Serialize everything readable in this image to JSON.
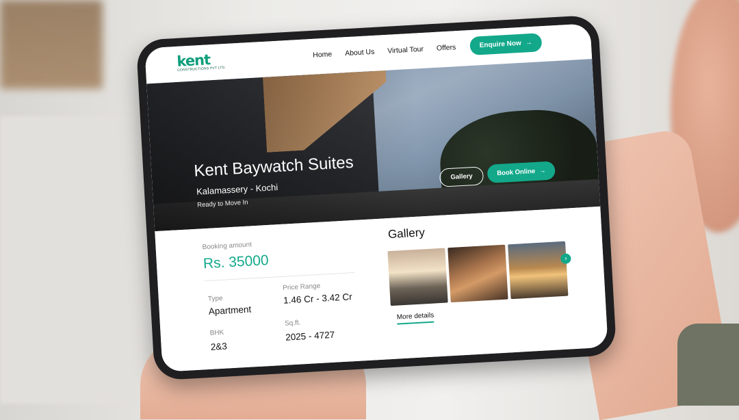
{
  "nav": {
    "logo_text": "kent",
    "logo_subtext": "CONSTRUCTIONS PVT LTD.",
    "links": [
      "Home",
      "About Us",
      "Virtual Tour",
      "Offers"
    ],
    "cta_label": "Enquire Now",
    "cta_icon": "arrow-right-icon"
  },
  "hero": {
    "title": "Kent Baywatch Suites",
    "location": "Kalamassery - Kochi",
    "status": "Ready to Move In",
    "gallery_button": "Gallery",
    "book_button": "Book Online"
  },
  "details": {
    "booking_label": "Booking amount",
    "booking_amount": "Rs. 35000",
    "type_label": "Type",
    "type_value": "Apartment",
    "price_label": "Price Range",
    "price_value": "1.46 Cr - 3.42 Cr",
    "bhk_label": "BHK",
    "bhk_value": "2&3",
    "sqft_label": "Sq.ft.",
    "sqft_value": "2025 - 4727"
  },
  "gallery": {
    "title": "Gallery",
    "next_icon": "chevron-right-icon",
    "more_label": "More details"
  },
  "colors": {
    "accent": "#13a88a",
    "brand": "#0e9e7c"
  }
}
